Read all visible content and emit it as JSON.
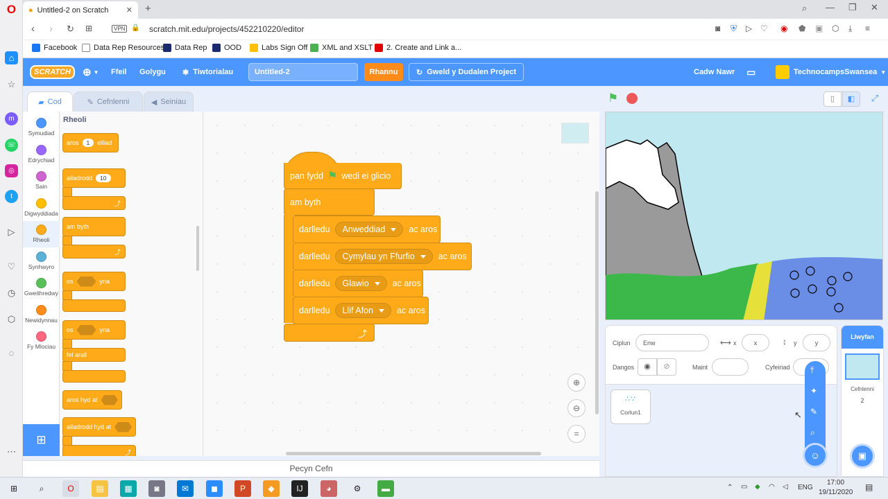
{
  "browser": {
    "tab_title": "Untitled-2 on Scratch",
    "url_vpn": "VPN",
    "url": "scratch.mit.edu/projects/452210220/editor",
    "bookmarks": [
      {
        "label": "Facebook",
        "color": "#1877f2"
      },
      {
        "label": "Data Rep Resources",
        "color": "#888888"
      },
      {
        "label": "Data Rep",
        "color": "#1a2a6c"
      },
      {
        "label": "OOD",
        "color": "#1a2a6c"
      },
      {
        "label": "Labs Sign Off",
        "color": "#ffc107"
      },
      {
        "label": "XML and XSLT",
        "color": "#4caf50"
      },
      {
        "label": "2. Create and Link a...",
        "color": "#e00000"
      }
    ]
  },
  "menu": {
    "file": "Ffeil",
    "edit": "Golygu",
    "tutorials": "Tiwtorialau",
    "project_title": "Untitled-2",
    "share": "Rhannu",
    "see_project": "Gweld y Dudalen Project",
    "save_now": "Cadw Nawr",
    "username": "TechnocampsSwansea"
  },
  "editor_tabs": {
    "code": "Cod",
    "costumes": "Cefnlenni",
    "sounds": "Seiniau"
  },
  "categories": [
    {
      "label": "Symudiad",
      "color": "#4c97ff"
    },
    {
      "label": "Edrychiad",
      "color": "#9966ff"
    },
    {
      "label": "Sain",
      "color": "#cf63cf"
    },
    {
      "label": "Digwyddiada",
      "color": "#ffbf00"
    },
    {
      "label": "Rheoli",
      "color": "#ffab19"
    },
    {
      "label": "Synhwyro",
      "color": "#5cb1d6"
    },
    {
      "label": "Gweithredwy",
      "color": "#59c059"
    },
    {
      "label": "Newidynnau",
      "color": "#ff8c1a"
    },
    {
      "label": "Fy Mlociau",
      "color": "#ff6680"
    }
  ],
  "palette": {
    "heading": "Rheoli",
    "wait_label": "aros",
    "wait_value": "1",
    "wait_suffix": "eiliad",
    "repeat_label": "ailadrodd",
    "repeat_value": "10",
    "forever_label": "am byth",
    "if_label": "os",
    "then_label": "yna",
    "if2_label": "os",
    "then2_label": "yna",
    "else_label": "fel arall",
    "wait_until_label": "aros hyd at",
    "repeat_until_label": "ailadrodd hyd at"
  },
  "script": {
    "hat_prefix": "pan fydd",
    "hat_suffix": "wedi ei glicio",
    "forever": "am byth",
    "broadcast_label": "darlledu",
    "and_wait": "ac aros",
    "messages": [
      "Anweddiad",
      "Cymylau yn Ffurfio",
      "Glawio",
      "Llif Afon"
    ]
  },
  "footer_label": "Pecyn Cefn",
  "sprite_info": {
    "sprite_label": "Ciplun",
    "name_placeholder": "Enw",
    "x_label": "x",
    "x_placeholder": "x",
    "y_label": "y",
    "y_placeholder": "y",
    "show_label": "Dangos",
    "size_label": "Maint",
    "direction_label": "Cyfeiriad"
  },
  "sprite": {
    "name": "Corlun1"
  },
  "stage_panel": {
    "title": "Llwyfan",
    "backdrops_label": "Cefnlenni",
    "backdrops_count": "2"
  },
  "taskbar": {
    "lang": "ENG",
    "time": "17:00",
    "date": "19/11/2020"
  }
}
